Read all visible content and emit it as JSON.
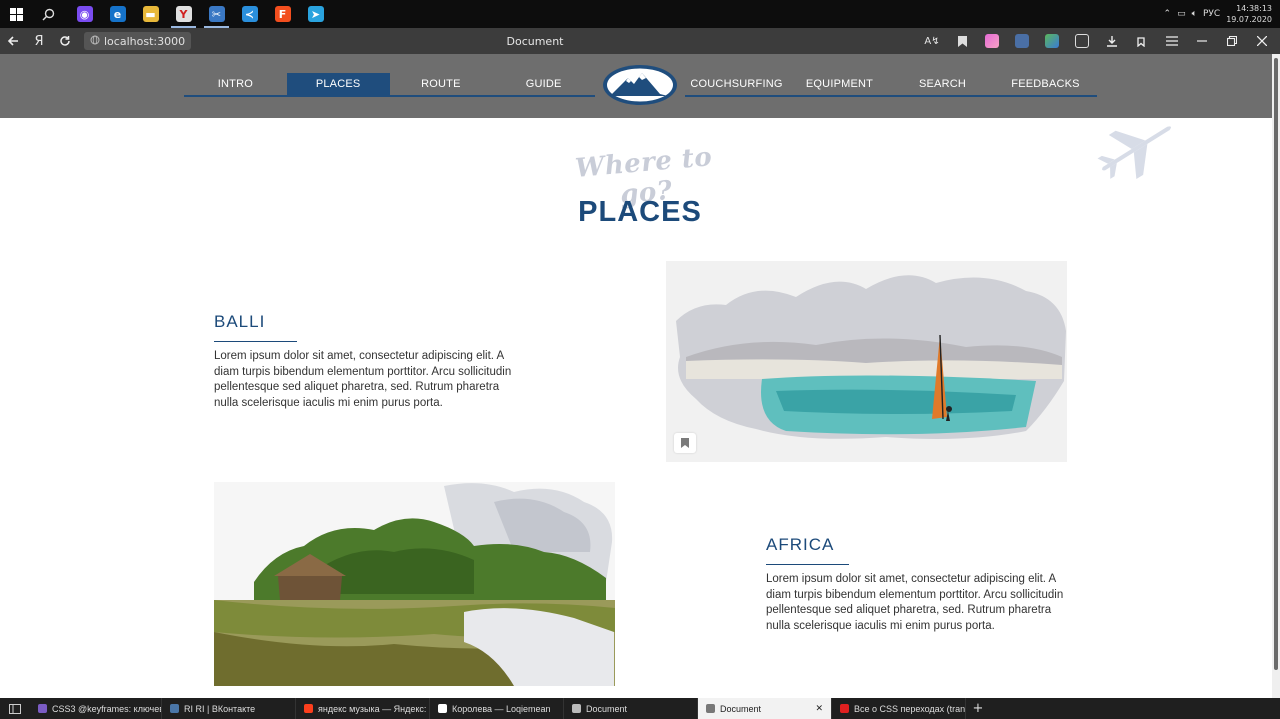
{
  "taskbar": {
    "pinned": [
      {
        "name": "alice-icon",
        "color": "#7a4cf0",
        "glyph": "◉"
      },
      {
        "name": "edge-icon",
        "color": "#1572c9",
        "glyph": "e"
      },
      {
        "name": "explorer-icon",
        "color": "#e8b83a",
        "glyph": "▬"
      },
      {
        "name": "yandex-browser-icon",
        "color": "#e0e0e0",
        "glyph": "Y"
      },
      {
        "name": "snipping-icon",
        "color": "#3a78c4",
        "glyph": "✂"
      },
      {
        "name": "vscode-icon",
        "color": "#2a8fdc",
        "glyph": "≺"
      },
      {
        "name": "figma-icon",
        "color": "#f24e1e",
        "glyph": "F"
      },
      {
        "name": "telegram-icon",
        "color": "#2aa3de",
        "glyph": "➤"
      }
    ],
    "lang": "РУС",
    "time": "14:38:13",
    "date": "19.07.2020"
  },
  "browser": {
    "url": "localhost:3000",
    "title": "Document",
    "yandex_glyph": "Я"
  },
  "nav": {
    "left": [
      "INTRO",
      "PLACES",
      "ROUTE",
      "GUIDE"
    ],
    "right": [
      "COUCHSURFING",
      "EQUIPMENT",
      "SEARCH",
      "FEEDBACKS"
    ],
    "active": "PLACES"
  },
  "hero": {
    "tagline": "Where to go?",
    "title": "PLACES"
  },
  "places": [
    {
      "name": "BALLI",
      "text": "Lorem ipsum dolor sit amet, consectetur adipiscing elit. A diam turpis bibendum elementum porttitor. Arcu sollicitudin pellentesque sed aliquet pharetra, sed. Rutrum pharetra nulla scelerisque iaculis mi enim purus porta."
    },
    {
      "name": "AFRICA",
      "text": "Lorem ipsum dolor sit amet, consectetur adipiscing elit. A diam turpis bibendum elementum porttitor. Arcu sollicitudin pellentesque sed aliquet pharetra, sed. Rutrum pharetra nulla scelerisque iaculis mi enim purus porta."
    }
  ],
  "tabs": [
    {
      "label": "CSS3 @keyframes: ключев",
      "color": "#7b5cc4"
    },
    {
      "label": "RI RI | ВКонтакте",
      "color": "#4a76a8"
    },
    {
      "label": "яндекс музыка — Яндекс:",
      "color": "#fc3f1d"
    },
    {
      "label": "Королева — Loqiemean",
      "color": "#ffffff"
    },
    {
      "label": "Document",
      "color": "#bbbbbb"
    },
    {
      "label": "Document",
      "color": "#777777",
      "active": true
    },
    {
      "label": "Все о CSS переходах (tran",
      "color": "#e02020"
    }
  ]
}
